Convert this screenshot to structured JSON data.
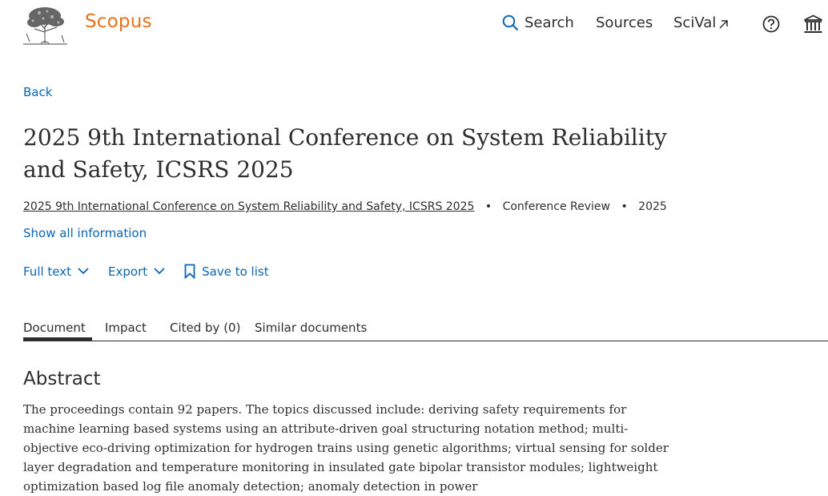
{
  "header": {
    "logo_text": "Scopus",
    "nav": {
      "search": "Search",
      "sources": "Sources",
      "scival": "SciVal"
    },
    "icons": {
      "search": "magnifier-icon",
      "external": "arrow-up-right-icon",
      "help": "question-circle-icon",
      "institution": "institution-icon"
    },
    "accent_color": "#e9711c",
    "link_color": "#0c65b5"
  },
  "back_label": "Back",
  "document": {
    "title": "2025 9th International Conference on System Reliability and Safety, ICSRS 2025",
    "source_title": "2025 9th International Conference on System Reliability and Safety, ICSRS 2025",
    "doc_type": "Conference Review",
    "year": "2025",
    "separator": "•",
    "show_all": "Show all information"
  },
  "actions": {
    "full_text": "Full text",
    "export": "Export",
    "save_to_list": "Save to list"
  },
  "tabs": [
    {
      "label": "Document",
      "active": true
    },
    {
      "label": "Impact",
      "active": false
    },
    {
      "label": "Cited by (0)",
      "active": false
    },
    {
      "label": "Similar documents",
      "active": false
    }
  ],
  "abstract": {
    "heading": "Abstract",
    "text": "The proceedings contain 92 papers. The topics discussed include: deriving safety requirements for machine learning based systems using an attribute-driven goal structuring notation method; multi-objective eco-driving optimization for hydrogen trains using genetic algorithms; virtual sensing for solder layer degradation and temperature monitoring in insulated gate bipolar transistor modules; lightweight optimization based log file anomaly detection; anomaly detection in power"
  }
}
